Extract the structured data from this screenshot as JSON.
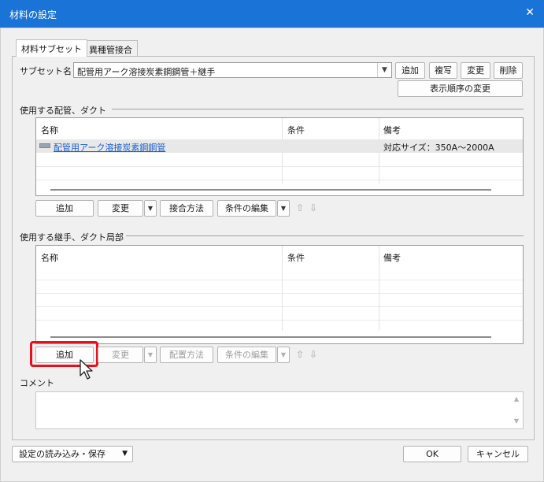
{
  "window": {
    "title": "材料の設定",
    "close_icon": "✕"
  },
  "tabs": [
    {
      "label": "材料サブセット",
      "active": true
    },
    {
      "label": "異種管接合",
      "active": false
    }
  ],
  "subset": {
    "label": "サブセット名",
    "value": "配管用アーク溶接炭素鋼鋼管＋継手",
    "buttons": {
      "add": "追加",
      "copy": "複写",
      "change": "変更",
      "delete": "削除"
    },
    "order_button": "表示順序の変更"
  },
  "pipes_group": {
    "title": "使用する配管、ダクト",
    "columns": [
      "名称",
      "条件",
      "備考"
    ],
    "rows": [
      {
        "name": "配管用アーク溶接炭素鋼鋼管",
        "condition": "",
        "note": "対応サイズ：350A～2000A"
      }
    ],
    "buttons": {
      "add": "追加",
      "change": "変更",
      "joint": "接合方法",
      "edit_cond": "条件の編集"
    }
  },
  "fittings_group": {
    "title": "使用する継手、ダクト局部",
    "columns": [
      "名称",
      "条件",
      "備考"
    ],
    "rows": [],
    "buttons": {
      "add": "追加",
      "change": "変更",
      "place": "配置方法",
      "edit_cond": "条件の編集"
    }
  },
  "comment": {
    "label": "コメント",
    "value": ""
  },
  "footer": {
    "load_save": "設定の読み込み・保存",
    "ok": "OK",
    "cancel": "キャンセル"
  },
  "colors": {
    "titlebar": "#1a73d6",
    "highlight": "#e8101a",
    "link": "#1a5fd0"
  }
}
